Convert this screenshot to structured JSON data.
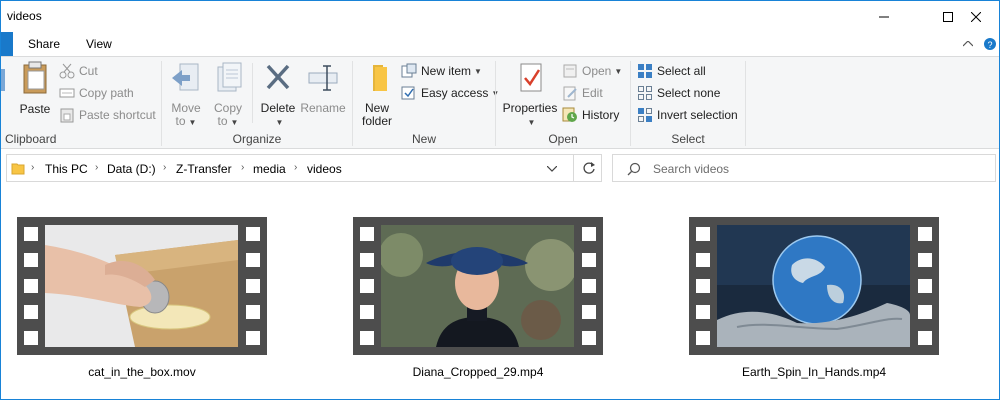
{
  "window": {
    "title": "videos"
  },
  "tabs": {
    "share": "Share",
    "view": "View"
  },
  "ribbon": {
    "clipboard": {
      "label": "Clipboard",
      "paste": "Paste",
      "cut": "Cut",
      "copy_path": "Copy path",
      "paste_shortcut": "Paste shortcut"
    },
    "organize": {
      "label": "Organize",
      "move_to": [
        "Move",
        "to"
      ],
      "copy_to": [
        "Copy",
        "to"
      ],
      "delete": "Delete",
      "rename": "Rename"
    },
    "new": {
      "label": "New",
      "new_folder": [
        "New",
        "folder"
      ],
      "new_item": "New item",
      "easy_access": "Easy access"
    },
    "open": {
      "label": "Open",
      "properties": "Properties",
      "open": "Open",
      "edit": "Edit",
      "history": "History"
    },
    "select": {
      "label": "Select",
      "select_all": "Select all",
      "select_none": "Select none",
      "invert_selection": "Invert selection"
    }
  },
  "address": {
    "breadcrumbs": [
      "This PC",
      "Data (D:)",
      "Z-Transfer",
      "media",
      "videos"
    ]
  },
  "search": {
    "placeholder": "Search videos"
  },
  "files": [
    {
      "name": "cat_in_the_box.mov"
    },
    {
      "name": "Diana_Cropped_29.mp4"
    },
    {
      "name": "Earth_Spin_In_Hands.mp4"
    }
  ],
  "colors": {
    "accent": "#1979ca",
    "folder": "#f8c545"
  }
}
